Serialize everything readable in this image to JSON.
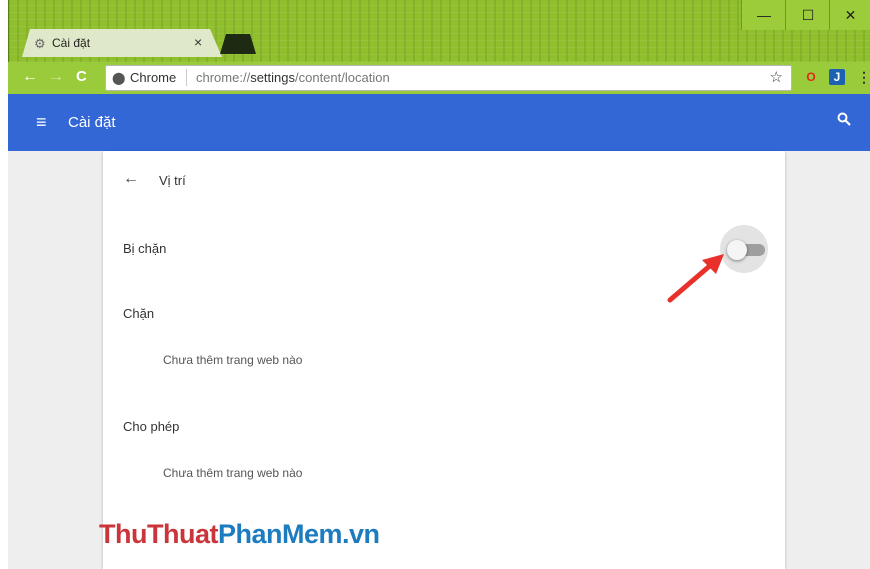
{
  "window": {
    "tab_title": "Cài đặt",
    "tab_close": "×",
    "minimize": "—",
    "maximize": "☐",
    "close": "✕"
  },
  "toolbar": {
    "back": "←",
    "forward": "→",
    "reload": "C",
    "security_label": "Chrome",
    "url_scheme": "chrome://",
    "url_host": "settings",
    "url_path": "/content/location",
    "bookmark": "☆",
    "extensions": [
      "O",
      "J",
      "⋮"
    ]
  },
  "appbar": {
    "menu": "≡",
    "title": "Cài đặt",
    "search": "🔍"
  },
  "page": {
    "back": "←",
    "title": "Vị trí",
    "toggle_label": "Bị chặn",
    "toggle_on": false,
    "blocked_header": "Chặn",
    "blocked_empty": "Chưa thêm trang web nào",
    "allowed_header": "Cho phép",
    "allowed_empty": "Chưa thêm trang web nào"
  },
  "watermark": {
    "part1": "ThuThuat",
    "part2": "PhanMem",
    "part3": ".vn"
  },
  "colors": {
    "titlebar": "#8fbf2d",
    "appbar": "#3367d6",
    "arrow": "#e8312a",
    "watermark_red": "#c9353a",
    "watermark_blue": "#1d7bbf"
  }
}
